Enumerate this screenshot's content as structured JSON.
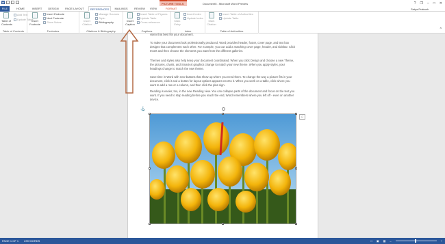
{
  "title_bar": {
    "document_title": "Document5 - Microsoft Word Preview",
    "context_group": "PICTURE TOOLS",
    "window_buttons": [
      "?",
      "❐",
      "–",
      "□",
      "✕"
    ]
  },
  "tabs": [
    "FILE",
    "HOME",
    "INSERT",
    "DESIGN",
    "PAGE LAYOUT",
    "REFERENCES",
    "MAILINGS",
    "REVIEW",
    "VIEW",
    "FORMAT"
  ],
  "active_tab": "REFERENCES",
  "user": "Satya Prakash",
  "ribbon": {
    "toc": {
      "big": "Table of Contents",
      "add_text": "Add Text",
      "update_table": "Update Table",
      "label": "Table of Contents"
    },
    "footnotes": {
      "big": "Insert Footnote",
      "insert_endnote": "Insert Endnote",
      "next_footnote": "Next Footnote",
      "show_notes": "Show Notes",
      "label": "Footnotes"
    },
    "citations": {
      "big": "Insert Citation",
      "manage_sources": "Manage Sources",
      "style": "Style:",
      "bibliography": "Bibliography",
      "label": "Citations & Bibliography"
    },
    "captions": {
      "big": "Insert Caption",
      "insert_tof": "Insert Table of Figures",
      "update_table": "Update Table",
      "cross_ref": "Cross-reference",
      "label": "Captions"
    },
    "index": {
      "big": "Mark Entry",
      "insert_index": "Insert Index",
      "update_index": "Update Index",
      "label": "Index"
    },
    "toa": {
      "big": "Mark Citation",
      "insert_toa": "Insert Table of Authorities",
      "update_table": "Update Table",
      "label": "Table of Authorities"
    }
  },
  "document": {
    "p0": "video that best fits your document.",
    "p1": "To make your document look professionally produced, Word provides header, footer, cover page, and text box designs that complement each other. For example, you can add a matching cover page, header, and sidebar. Click Insert and then choose the elements you want from the different galleries.",
    "p2": "Themes and styles also help keep your document coordinated. When you click Design and choose a new Theme, the pictures, charts, and SmartArt graphics change to match your new theme. When you apply styles, your headings change to match the new theme.",
    "p3": "Save time in Word with new buttons that show up where you need them. To change the way a picture fits in your document, click it and a button for layout options appears next to it. When you work on a table, click where you want to add a row or a column, and then click the plus sign.",
    "p4": "Reading is easier, too, in the new Reading view. You can collapse parts of the document and focus on the text you want. If you need to stop reading before you reach the end, Word remembers where you left off - even on another device."
  },
  "status": {
    "page": "PAGE 1 OF 1",
    "words": "239 WORDS"
  },
  "colors": {
    "accent": "#2b579a",
    "context": "#d24726",
    "arrow": "#b46a45"
  }
}
